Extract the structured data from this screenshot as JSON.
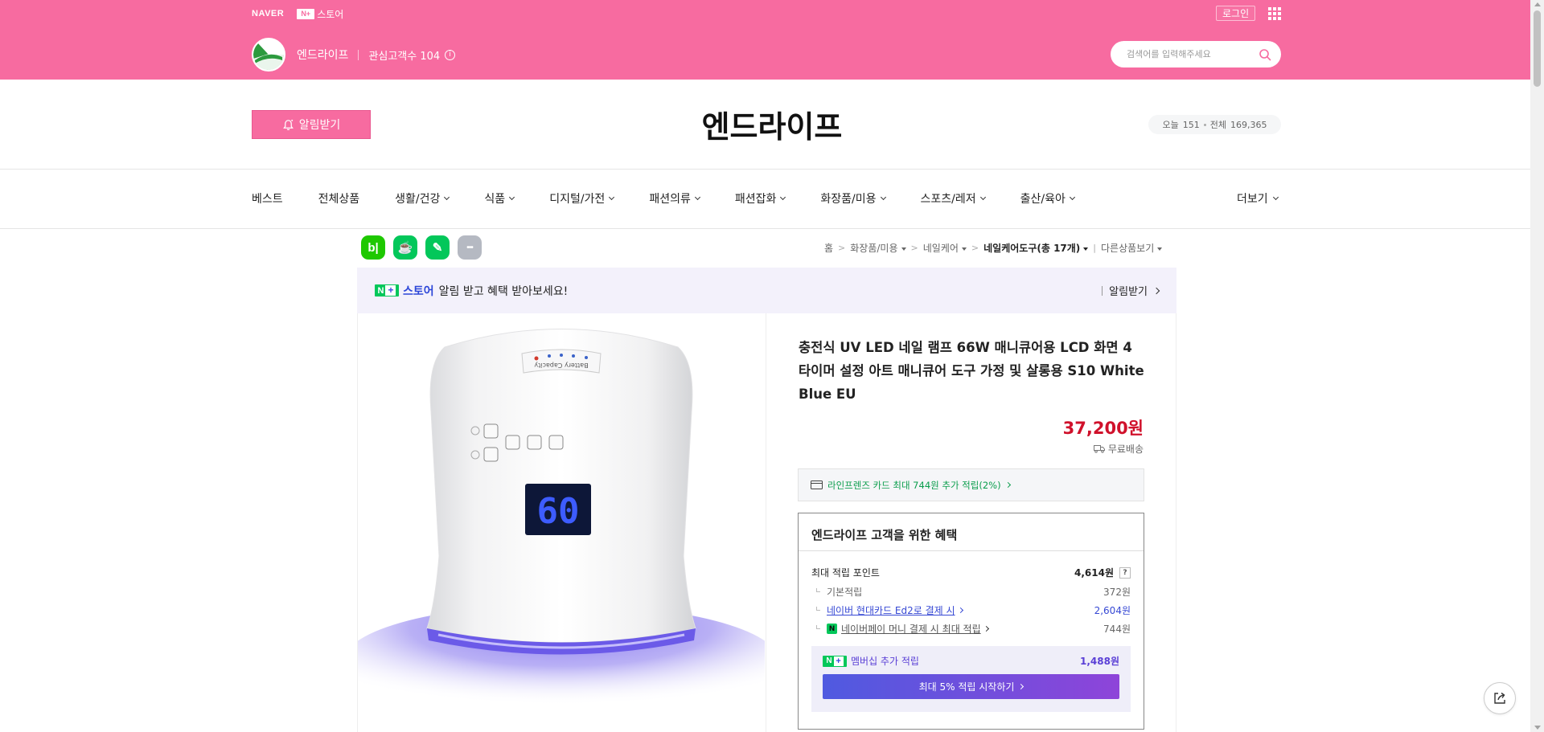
{
  "colors": {
    "brand_pink": "#f76ba0",
    "price_red": "#d0112b",
    "npay_green": "#03c75a",
    "accent_blue": "#3648d4",
    "member_purple": "#5a3fd6"
  },
  "gnb": {
    "naver_logo": "NAVER",
    "nplus_badge": "N+",
    "store_label": "스토어",
    "login_label": "로그인",
    "apps_icon": "grid-icon"
  },
  "store": {
    "name": "엔드라이프",
    "fans_label": "관심고객수",
    "fans_count": "104"
  },
  "search": {
    "placeholder": "검색어를 입력해주세요",
    "value": ""
  },
  "header": {
    "notify_label": "알림받기",
    "title": "엔드라이프",
    "today_label": "오늘",
    "today_count": "151",
    "total_label": "전체",
    "total_count": "169,365"
  },
  "categories": [
    {
      "label": "베스트",
      "dropdown": false
    },
    {
      "label": "전체상품",
      "dropdown": false
    },
    {
      "label": "생활/건강",
      "dropdown": true
    },
    {
      "label": "식품",
      "dropdown": true
    },
    {
      "label": "디지털/가전",
      "dropdown": true
    },
    {
      "label": "패션의류",
      "dropdown": true
    },
    {
      "label": "패션잡화",
      "dropdown": true
    },
    {
      "label": "화장품/미용",
      "dropdown": true
    },
    {
      "label": "스포츠/레저",
      "dropdown": true
    },
    {
      "label": "출산/육아",
      "dropdown": true
    }
  ],
  "more_label": "더보기",
  "share": [
    {
      "name": "band",
      "glyph": "b|",
      "color": "#1ec800"
    },
    {
      "name": "cafe",
      "glyph": "☕",
      "color": "#03c75a"
    },
    {
      "name": "blog",
      "glyph": "✎",
      "color": "#03c75a"
    },
    {
      "name": "more",
      "glyph": "•••",
      "color": "#b5b9c2"
    }
  ],
  "breadcrumb": {
    "home": "홈",
    "c1": "화장품/미용",
    "c2": "네일케어",
    "c3": "네일케어도구(총 17개)",
    "other": "다른상품보기"
  },
  "banner": {
    "nplus": "N",
    "store": "스토어",
    "message": "알림 받고 혜택 받아보세요!",
    "action": "알림받기"
  },
  "product": {
    "title": "충전식 UV LED 네일 램프 66W 매니큐어용 LCD 화면 4 타이머 설정 아트 매니큐어 도구 가정 및 살롱용 S10 White Blue EU",
    "price": "37,200원",
    "shipping": "무료배송",
    "lamp_display": "60",
    "lamp_text": "Battery Capacity",
    "card_offer": "라인프렌즈 카드 최대 744원 추가 적립(2%)"
  },
  "benefit": {
    "title": "엔드라이프 고객을 위한 혜택",
    "max_label": "최대 적립 포인트",
    "max_value": "4,614원",
    "help": "?",
    "rows": [
      {
        "label": "기본적립",
        "value": "372원"
      },
      {
        "label": "네이버 현대카드 Ed2로 결제 시",
        "value": "2,604원"
      },
      {
        "label": "네이버페이 머니 결제 시 최대 적립",
        "value": "744원"
      }
    ],
    "member_label": "멤버십 추가 적립",
    "member_value": "1,488원",
    "member_cta": "최대 5% 적립 시작하기"
  }
}
